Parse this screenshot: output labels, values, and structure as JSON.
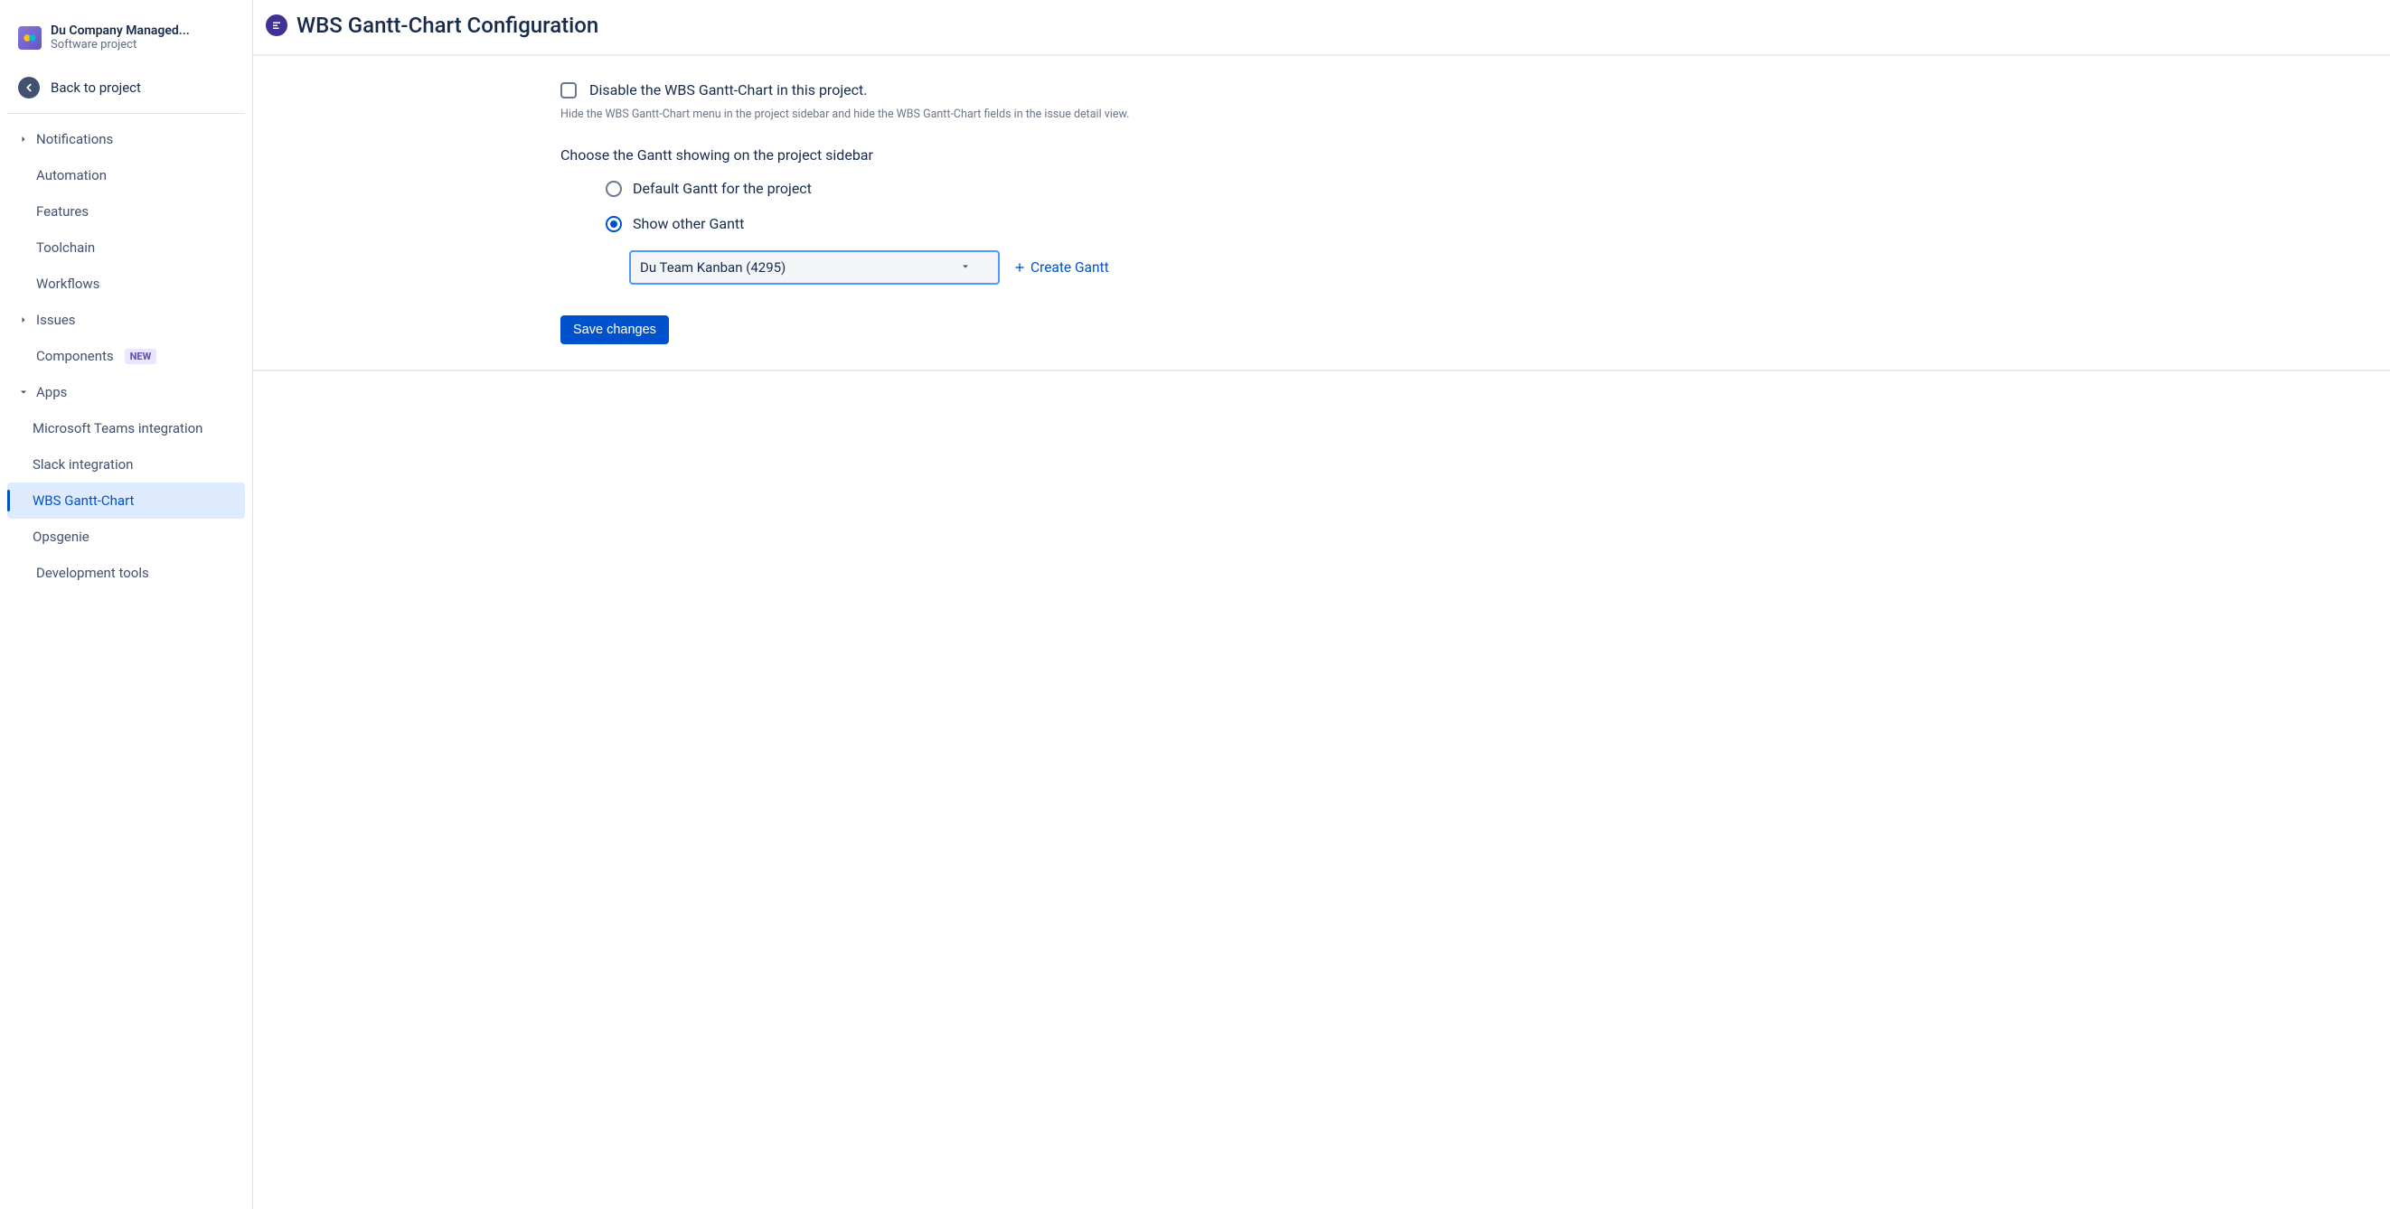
{
  "project": {
    "name": "Du Company Managed...",
    "type": "Software project"
  },
  "back_label": "Back to project",
  "nav": {
    "notifications": "Notifications",
    "automation": "Automation",
    "features": "Features",
    "toolchain": "Toolchain",
    "workflows": "Workflows",
    "issues": "Issues",
    "components": "Components",
    "components_badge": "NEW",
    "apps": "Apps",
    "ms_teams": "Microsoft Teams integration",
    "slack": "Slack integration",
    "wbs": "WBS Gantt-Chart",
    "opsgenie": "Opsgenie",
    "dev_tools": "Development tools"
  },
  "page": {
    "title": "WBS Gantt-Chart Configuration",
    "disable_label": "Disable the WBS Gantt-Chart in this project.",
    "disable_hint": "Hide the WBS Gantt-Chart menu in the project sidebar and hide the WBS Gantt-Chart fields in the issue detail view.",
    "choose_label": "Choose the Gantt showing on the project sidebar",
    "radio_default": "Default Gantt for the project",
    "radio_other": "Show other Gantt",
    "selected_gantt": "Du Team Kanban (4295)",
    "create_gantt": "Create Gantt",
    "save_label": "Save changes"
  }
}
